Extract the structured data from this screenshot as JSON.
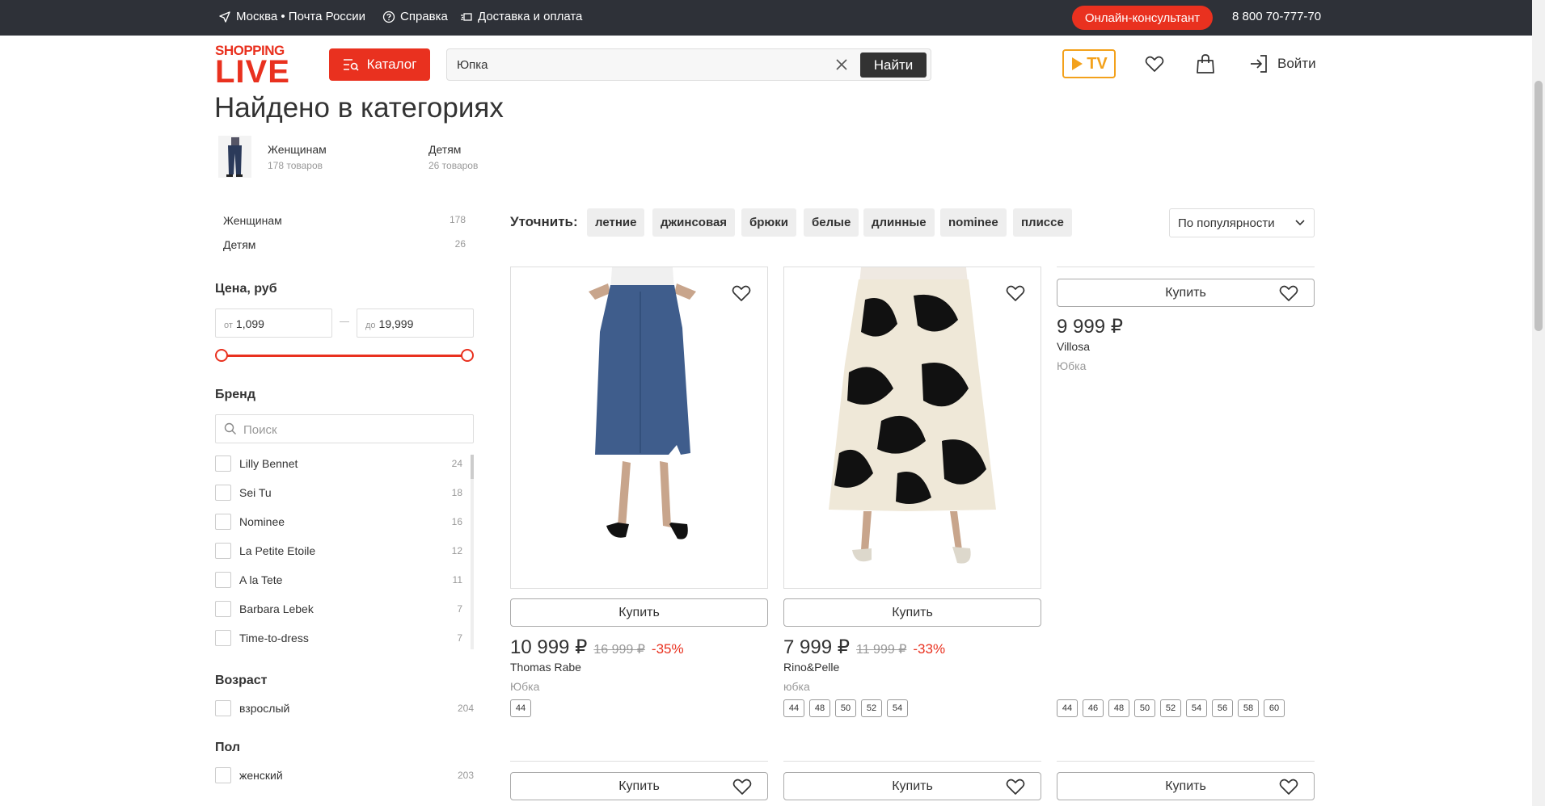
{
  "topbar": {
    "location": "Москва • Почта России",
    "help": "Справка",
    "delivery": "Доставка и оплата",
    "consultant": "Онлайн-консультант",
    "phone": "8 800 70-777-70"
  },
  "header": {
    "logo_top": "SHOPPING",
    "logo_bottom": "LIVE",
    "catalog": "Каталог",
    "search_value": "Юпка",
    "search_button": "Найти",
    "tv_label": "TV",
    "login": "Войти"
  },
  "found": {
    "title": "Найдено в категориях",
    "categories": [
      {
        "name": "Женщинам",
        "count": "178 товаров"
      },
      {
        "name": "Детям",
        "count": "26 товаров"
      }
    ]
  },
  "sidebar": {
    "categories": [
      {
        "name": "Женщинам",
        "count": "178"
      },
      {
        "name": "Детям",
        "count": "26"
      }
    ],
    "price": {
      "title": "Цена, руб",
      "from_prefix": "от",
      "from_value": "1,099",
      "to_prefix": "до",
      "to_value": "19,999",
      "slider_low_fraction": 0,
      "slider_high_fraction": 1
    },
    "brand": {
      "title": "Бренд",
      "search_placeholder": "Поиск",
      "items": [
        {
          "name": "Lilly Bennet",
          "count": "24"
        },
        {
          "name": "Sei Tu",
          "count": "18"
        },
        {
          "name": "Nominee",
          "count": "16"
        },
        {
          "name": "La Petite Etoile",
          "count": "12"
        },
        {
          "name": "A la Tete",
          "count": "11"
        },
        {
          "name": "Barbara Lebek",
          "count": "7"
        },
        {
          "name": "Time-to-dress",
          "count": "7"
        }
      ]
    },
    "age": {
      "title": "Возраст",
      "items": [
        {
          "name": "взрослый",
          "count": "204"
        }
      ]
    },
    "gender": {
      "title": "Пол",
      "items": [
        {
          "name": "женский",
          "count": "203"
        }
      ]
    }
  },
  "refine": {
    "label": "Уточнить:",
    "chips": [
      "летние",
      "джинсовая",
      "брюки",
      "белые",
      "длинные",
      "nominee",
      "плиссе"
    ],
    "sort": "По популярности"
  },
  "products": [
    {
      "buy": "Купить",
      "price": "10 999 ₽",
      "old_price": "16 999 ₽",
      "discount": "-35%",
      "brand": "Thomas Rabe",
      "type": "Юбка",
      "sizes": [
        "44"
      ]
    },
    {
      "buy": "Купить",
      "price": "7 999 ₽",
      "old_price": "11 999 ₽",
      "discount": "-33%",
      "brand": "Rino&Pelle",
      "type": "юбка",
      "sizes": [
        "44",
        "48",
        "50",
        "52",
        "54"
      ]
    },
    {
      "buy": "Купить",
      "price": "9 999 ₽",
      "brand": "Villosa",
      "type": "Юбка",
      "sizes": [
        "44",
        "46",
        "48",
        "50",
        "52",
        "54",
        "56",
        "58",
        "60"
      ]
    }
  ],
  "next_row": [
    {
      "buy": "Купить"
    },
    {
      "buy": "Купить"
    },
    {
      "buy": "Купить"
    }
  ],
  "colors": {
    "accent": "#e9311f",
    "topbar": "#2e3138",
    "tv": "#f3a11b"
  }
}
